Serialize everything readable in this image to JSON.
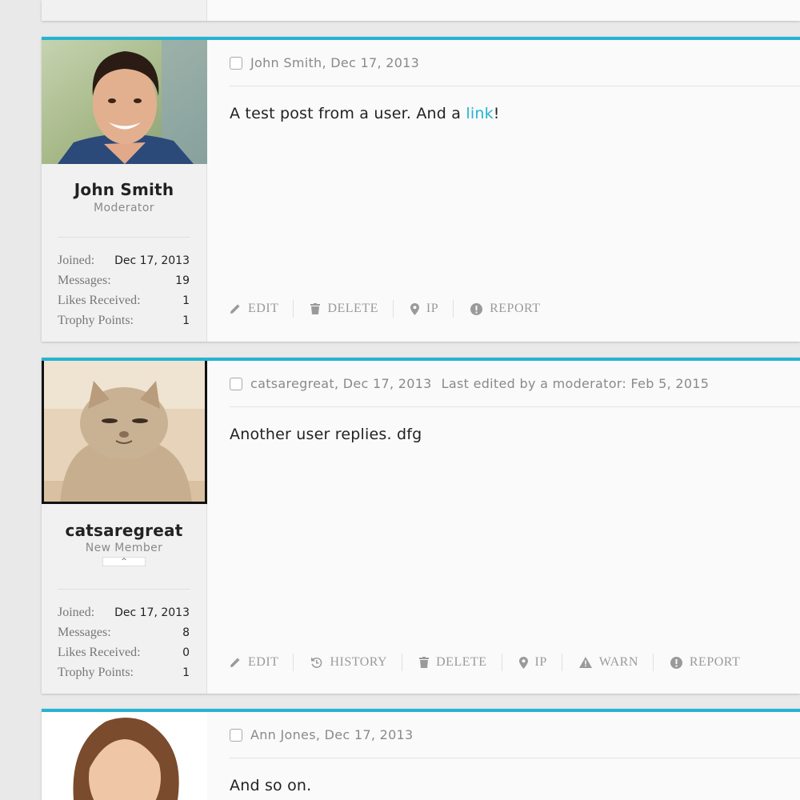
{
  "colors": {
    "accent": "#23b4d2",
    "background": "#e9e9e9"
  },
  "posts": [
    {
      "user": {
        "name": "John Smith",
        "title": "Moderator",
        "badge": ""
      },
      "stats": [
        {
          "label": "Joined:",
          "value": "Dec 17, 2013"
        },
        {
          "label": "Messages:",
          "value": "19"
        },
        {
          "label": "Likes Received:",
          "value": "1"
        },
        {
          "label": "Trophy Points:",
          "value": "1"
        }
      ],
      "meta": "John Smith, Dec 17, 2013",
      "edited": "",
      "body_text": "A test post from a user. And a ",
      "body_link": "link",
      "body_after": "!",
      "actions": {
        "edit": "EDIT",
        "delete": "DELETE",
        "ip": "IP",
        "report": "REPORT"
      }
    },
    {
      "user": {
        "name": "catsaregreat",
        "title": "New Member",
        "badge": "^"
      },
      "stats": [
        {
          "label": "Joined:",
          "value": "Dec 17, 2013"
        },
        {
          "label": "Messages:",
          "value": "8"
        },
        {
          "label": "Likes Received:",
          "value": "0"
        },
        {
          "label": "Trophy Points:",
          "value": "1"
        }
      ],
      "meta": "catsaregreat, Dec 17, 2013",
      "edited": "Last edited by a moderator: Feb 5, 2015",
      "body_text": "Another user replies. dfg",
      "actions": {
        "edit": "EDIT",
        "history": "HISTORY",
        "delete": "DELETE",
        "ip": "IP",
        "warn": "WARN",
        "report": "REPORT"
      }
    },
    {
      "user": {
        "name": "Ann Jones"
      },
      "meta": "Ann Jones, Dec 17, 2013",
      "body_text": "And so on."
    }
  ]
}
